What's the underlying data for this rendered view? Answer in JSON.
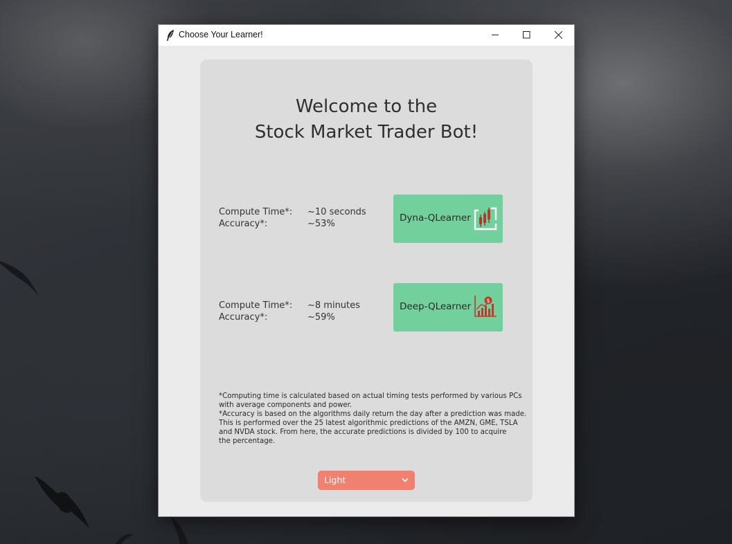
{
  "window": {
    "title": "Choose Your Learner!"
  },
  "welcome": {
    "line1": "Welcome to the",
    "line2": "Stock Market Trader Bot!"
  },
  "learners": [
    {
      "button_label": "Dyna-QLearner",
      "icon": "candlestick-chart-icon",
      "compute_label": "Compute Time*:",
      "compute_value": "~10 seconds",
      "accuracy_label": "Accuracy*:",
      "accuracy_value": "~53%"
    },
    {
      "button_label": "Deep-QLearner",
      "icon": "dollar-growth-chart-icon",
      "compute_label": "Compute Time*:",
      "compute_value": "~8 minutes",
      "accuracy_label": "Accuracy*:",
      "accuracy_value": "~59%"
    }
  ],
  "notes": [
    "*Computing time is calculated based on actual timing tests performed by various PCs",
    "with average components and power.",
    "*Accuracy is based on the algorithms daily return the day after a prediction was made.",
    "This is performed over the 25 latest algorithmic predictions of the AMZN, GME, TSLA",
    "and NVDA stock. From here, the accurate predictions is divided by 100 to acquire",
    "the percentage."
  ],
  "theme": {
    "selected": "Light"
  },
  "colors": {
    "button_green": "#72d09c",
    "dropdown_coral": "#f08070",
    "icon_red": "#c0392b",
    "card_bg": "#dcdcdc"
  }
}
